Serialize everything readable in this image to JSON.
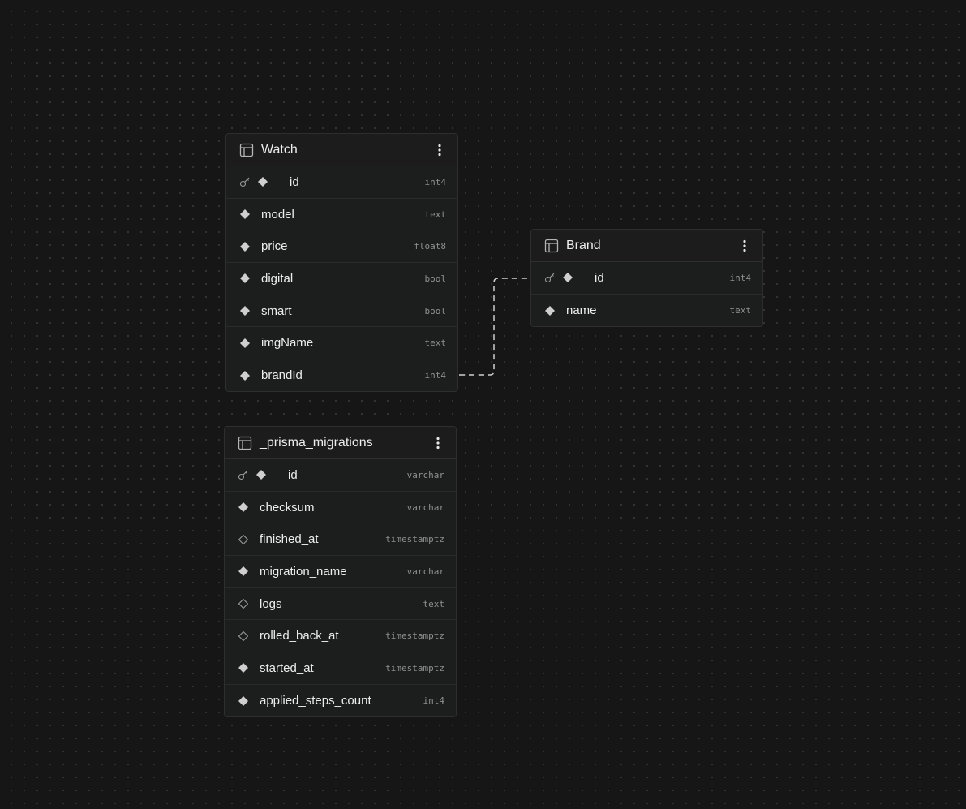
{
  "canvas": {
    "background": "#161616",
    "dot_color": "#3a3a3a",
    "edge_color": "#cfcfcf"
  },
  "tables": {
    "watch": {
      "name": "Watch",
      "columns": [
        {
          "name": "id",
          "type": "int4",
          "primary_key": true,
          "nullable": false
        },
        {
          "name": "model",
          "type": "text",
          "primary_key": false,
          "nullable": false
        },
        {
          "name": "price",
          "type": "float8",
          "primary_key": false,
          "nullable": false
        },
        {
          "name": "digital",
          "type": "bool",
          "primary_key": false,
          "nullable": false
        },
        {
          "name": "smart",
          "type": "bool",
          "primary_key": false,
          "nullable": false
        },
        {
          "name": "imgName",
          "type": "text",
          "primary_key": false,
          "nullable": false
        },
        {
          "name": "brandId",
          "type": "int4",
          "primary_key": false,
          "nullable": false
        }
      ]
    },
    "brand": {
      "name": "Brand",
      "columns": [
        {
          "name": "id",
          "type": "int4",
          "primary_key": true,
          "nullable": false
        },
        {
          "name": "name",
          "type": "text",
          "primary_key": false,
          "nullable": false
        }
      ]
    },
    "prisma_migrations": {
      "name": "_prisma_migrations",
      "columns": [
        {
          "name": "id",
          "type": "varchar",
          "primary_key": true,
          "nullable": false
        },
        {
          "name": "checksum",
          "type": "varchar",
          "primary_key": false,
          "nullable": false
        },
        {
          "name": "finished_at",
          "type": "timestamptz",
          "primary_key": false,
          "nullable": true
        },
        {
          "name": "migration_name",
          "type": "varchar",
          "primary_key": false,
          "nullable": false
        },
        {
          "name": "logs",
          "type": "text",
          "primary_key": false,
          "nullable": true
        },
        {
          "name": "rolled_back_at",
          "type": "timestamptz",
          "primary_key": false,
          "nullable": true
        },
        {
          "name": "started_at",
          "type": "timestamptz",
          "primary_key": false,
          "nullable": false
        },
        {
          "name": "applied_steps_count",
          "type": "int4",
          "primary_key": false,
          "nullable": false
        }
      ]
    }
  },
  "relations": [
    {
      "from_table": "watch",
      "from_column": "brandId",
      "to_table": "brand",
      "to_column": "id"
    }
  ],
  "icons": {
    "table": "table-icon",
    "menu": "more-vertical-icon",
    "primary_key": "key-icon",
    "not_null": "diamond-filled-icon",
    "nullable": "diamond-outline-icon"
  }
}
